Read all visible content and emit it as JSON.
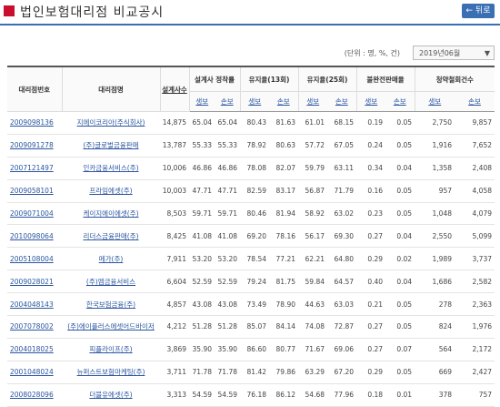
{
  "header": {
    "title": "법인보험대리점 비교공시",
    "back_label": "← 뒤로"
  },
  "filter": {
    "unit": "(단위 : 명, %, 건)",
    "period": "2019년06월"
  },
  "table": {
    "headers": {
      "code": "대리점번호",
      "name": "대리점명",
      "planners": "설계사수",
      "establish_rate": "설계사 정착률",
      "retention13": "유지율(13회)",
      "retention25": "유지율(25회)",
      "incomplete": "불완전판매율",
      "cancel": "청약철회건수"
    },
    "sub": {
      "life": "생보",
      "nonlife": "손보"
    },
    "rows": [
      {
        "code": "2009098136",
        "name": "지에이코리아(주식회사)",
        "planners": "14,875",
        "est_l": "65.04",
        "est_n": "65.04",
        "r13_l": "80.43",
        "r13_n": "81.63",
        "r25_l": "61.01",
        "r25_n": "68.15",
        "inc_l": "0.19",
        "inc_n": "0.05",
        "can_l": "2,750",
        "can_n": "9,857"
      },
      {
        "code": "2009091278",
        "name": "(주)글로벌금융판매",
        "planners": "13,787",
        "est_l": "55.33",
        "est_n": "55.33",
        "r13_l": "78.92",
        "r13_n": "80.63",
        "r25_l": "57.72",
        "r25_n": "67.05",
        "inc_l": "0.24",
        "inc_n": "0.05",
        "can_l": "1,916",
        "can_n": "7,652"
      },
      {
        "code": "2007121497",
        "name": "인카금융서비스(주)",
        "planners": "10,006",
        "est_l": "46.86",
        "est_n": "46.86",
        "r13_l": "78.08",
        "r13_n": "82.07",
        "r25_l": "59.79",
        "r25_n": "63.11",
        "inc_l": "0.34",
        "inc_n": "0.04",
        "can_l": "1,358",
        "can_n": "2,408"
      },
      {
        "code": "2009058101",
        "name": "프라임에셋(주)",
        "planners": "10,003",
        "est_l": "47.71",
        "est_n": "47.71",
        "r13_l": "82.59",
        "r13_n": "83.17",
        "r25_l": "56.87",
        "r25_n": "71.79",
        "inc_l": "0.16",
        "inc_n": "0.05",
        "can_l": "957",
        "can_n": "4,058"
      },
      {
        "code": "2009071004",
        "name": "케이지에이에셋(주)",
        "planners": "8,503",
        "est_l": "59.71",
        "est_n": "59.71",
        "r13_l": "80.46",
        "r13_n": "81.94",
        "r25_l": "58.92",
        "r25_n": "63.02",
        "inc_l": "0.23",
        "inc_n": "0.05",
        "can_l": "1,048",
        "can_n": "4,079"
      },
      {
        "code": "2010098064",
        "name": "리더스금융판매(주)",
        "planners": "8,425",
        "est_l": "41.08",
        "est_n": "41.08",
        "r13_l": "69.20",
        "r13_n": "78.16",
        "r25_l": "56.17",
        "r25_n": "69.30",
        "inc_l": "0.27",
        "inc_n": "0.04",
        "can_l": "2,550",
        "can_n": "5,099"
      },
      {
        "code": "2005108004",
        "name": "메가(주)",
        "planners": "7,911",
        "est_l": "53.20",
        "est_n": "53.20",
        "r13_l": "78.54",
        "r13_n": "77.21",
        "r25_l": "62.21",
        "r25_n": "64.80",
        "inc_l": "0.29",
        "inc_n": "0.02",
        "can_l": "1,989",
        "can_n": "3,737"
      },
      {
        "code": "2009028021",
        "name": "(주)엠금융서비스",
        "planners": "6,604",
        "est_l": "52.59",
        "est_n": "52.59",
        "r13_l": "79.24",
        "r13_n": "81.75",
        "r25_l": "59.84",
        "r25_n": "64.57",
        "inc_l": "0.40",
        "inc_n": "0.04",
        "can_l": "1,686",
        "can_n": "2,582"
      },
      {
        "code": "2004048143",
        "name": "한국보험금융(주)",
        "planners": "4,857",
        "est_l": "43.08",
        "est_n": "43.08",
        "r13_l": "73.49",
        "r13_n": "78.90",
        "r25_l": "44.63",
        "r25_n": "63.03",
        "inc_l": "0.21",
        "inc_n": "0.05",
        "can_l": "278",
        "can_n": "2,363"
      },
      {
        "code": "2007078002",
        "name": "(주)에이플러스에셋어드바이저",
        "planners": "4,212",
        "est_l": "51.28",
        "est_n": "51.28",
        "r13_l": "85.07",
        "r13_n": "84.14",
        "r25_l": "74.08",
        "r25_n": "72.87",
        "inc_l": "0.27",
        "inc_n": "0.05",
        "can_l": "824",
        "can_n": "1,976"
      },
      {
        "code": "2004018025",
        "name": "피플라이프(주)",
        "planners": "3,869",
        "est_l": "35.90",
        "est_n": "35.90",
        "r13_l": "86.60",
        "r13_n": "80.77",
        "r25_l": "71.67",
        "r25_n": "69.06",
        "inc_l": "0.27",
        "inc_n": "0.07",
        "can_l": "564",
        "can_n": "2,172"
      },
      {
        "code": "2001048024",
        "name": "뉴퍼스트보험마케팅(주)",
        "planners": "3,711",
        "est_l": "71.78",
        "est_n": "71.78",
        "r13_l": "81.42",
        "r13_n": "79.86",
        "r25_l": "63.29",
        "r25_n": "67.20",
        "inc_l": "0.29",
        "inc_n": "0.05",
        "can_l": "669",
        "can_n": "2,427"
      },
      {
        "code": "2008028096",
        "name": "더블유에셋(주)",
        "planners": "3,313",
        "est_l": "54.59",
        "est_n": "54.59",
        "r13_l": "76.18",
        "r13_n": "86.12",
        "r25_l": "54.68",
        "r25_n": "77.96",
        "inc_l": "0.18",
        "inc_n": "0.01",
        "can_l": "378",
        "can_n": "757"
      }
    ]
  }
}
